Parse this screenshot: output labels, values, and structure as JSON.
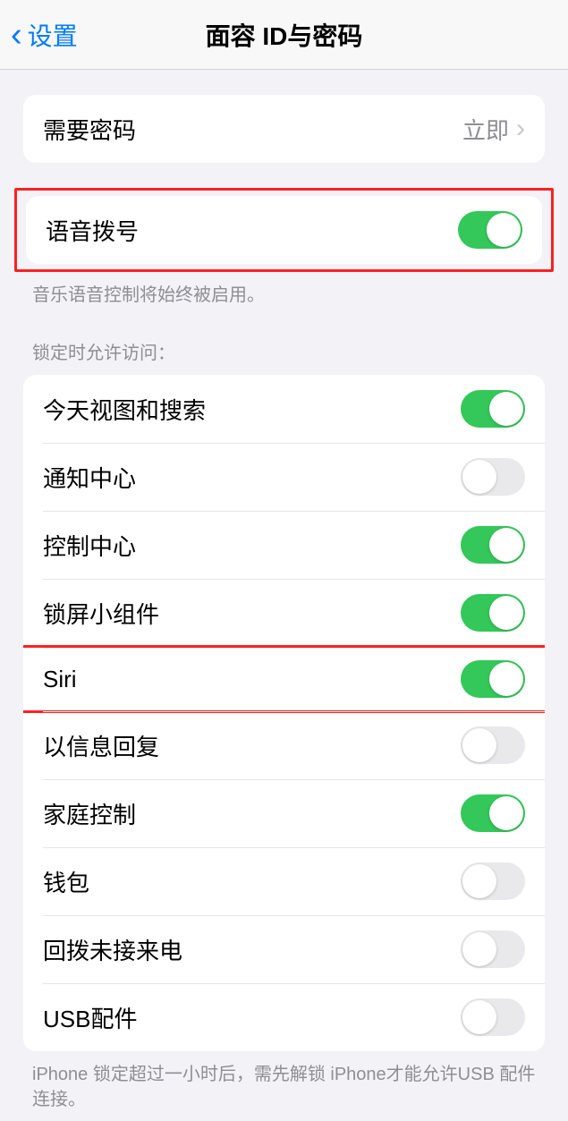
{
  "navbar": {
    "back_label": "设置",
    "title": "面容 ID与密码"
  },
  "passcode_group": {
    "require_passcode_label": "需要密码",
    "require_passcode_value": "立即"
  },
  "voice_dial": {
    "label": "语音拨号",
    "on": true,
    "footer": "音乐语音控制将始终被启用。"
  },
  "locked_access": {
    "header": "锁定时允许访问：",
    "items": [
      {
        "label": "今天视图和搜索",
        "on": true
      },
      {
        "label": "通知中心",
        "on": false
      },
      {
        "label": "控制中心",
        "on": true
      },
      {
        "label": "锁屏小组件",
        "on": true
      },
      {
        "label": "Siri",
        "on": true
      },
      {
        "label": "以信息回复",
        "on": false
      },
      {
        "label": "家庭控制",
        "on": true
      },
      {
        "label": "钱包",
        "on": false
      },
      {
        "label": "回拨未接来电",
        "on": false
      },
      {
        "label": "USB配件",
        "on": false
      }
    ],
    "footer": "iPhone 锁定超过一小时后，需先解锁 iPhone才能允许USB 配件连接。"
  }
}
